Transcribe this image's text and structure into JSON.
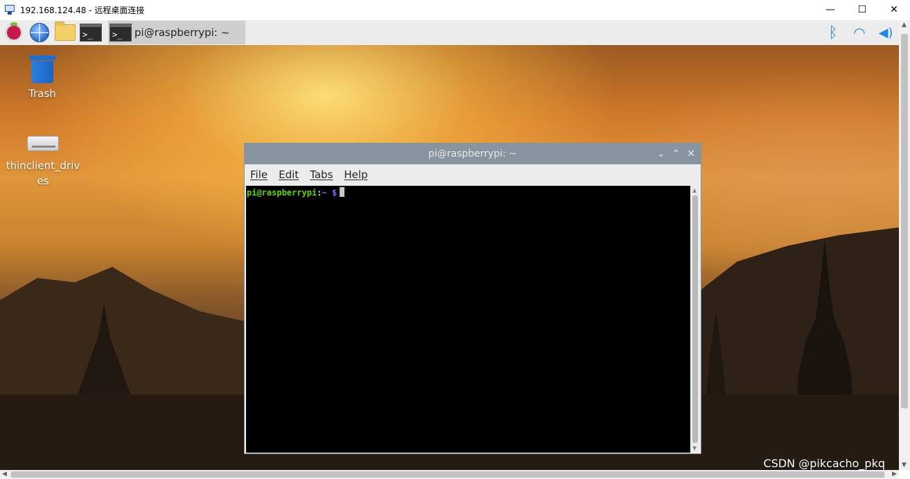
{
  "rdp": {
    "title": "192.168.124.48 - 远程桌面连接",
    "minimize": "—",
    "maximize": "☐",
    "close": "✕"
  },
  "panel": {
    "task_label": "pi@raspberrypi: ~",
    "icons": [
      "raspberry-menu-icon",
      "web-browser-icon",
      "file-manager-icon",
      "terminal-launcher-icon"
    ],
    "tray": [
      "bluetooth-icon",
      "wifi-icon",
      "volume-icon"
    ]
  },
  "desktop": {
    "icons": [
      {
        "label": "Trash"
      },
      {
        "label": "thinclient_drives"
      }
    ],
    "watermark": "CSDN @pikcacho_pkq"
  },
  "terminal": {
    "title": "pi@raspberrypi: ~",
    "menu": [
      "File",
      "Edit",
      "Tabs",
      "Help"
    ],
    "prompt_user": "pi@raspberrypi",
    "prompt_sep": ":",
    "prompt_path": "~ $",
    "controls": {
      "min": "⌄",
      "max": "⌃",
      "close": "✕"
    }
  }
}
